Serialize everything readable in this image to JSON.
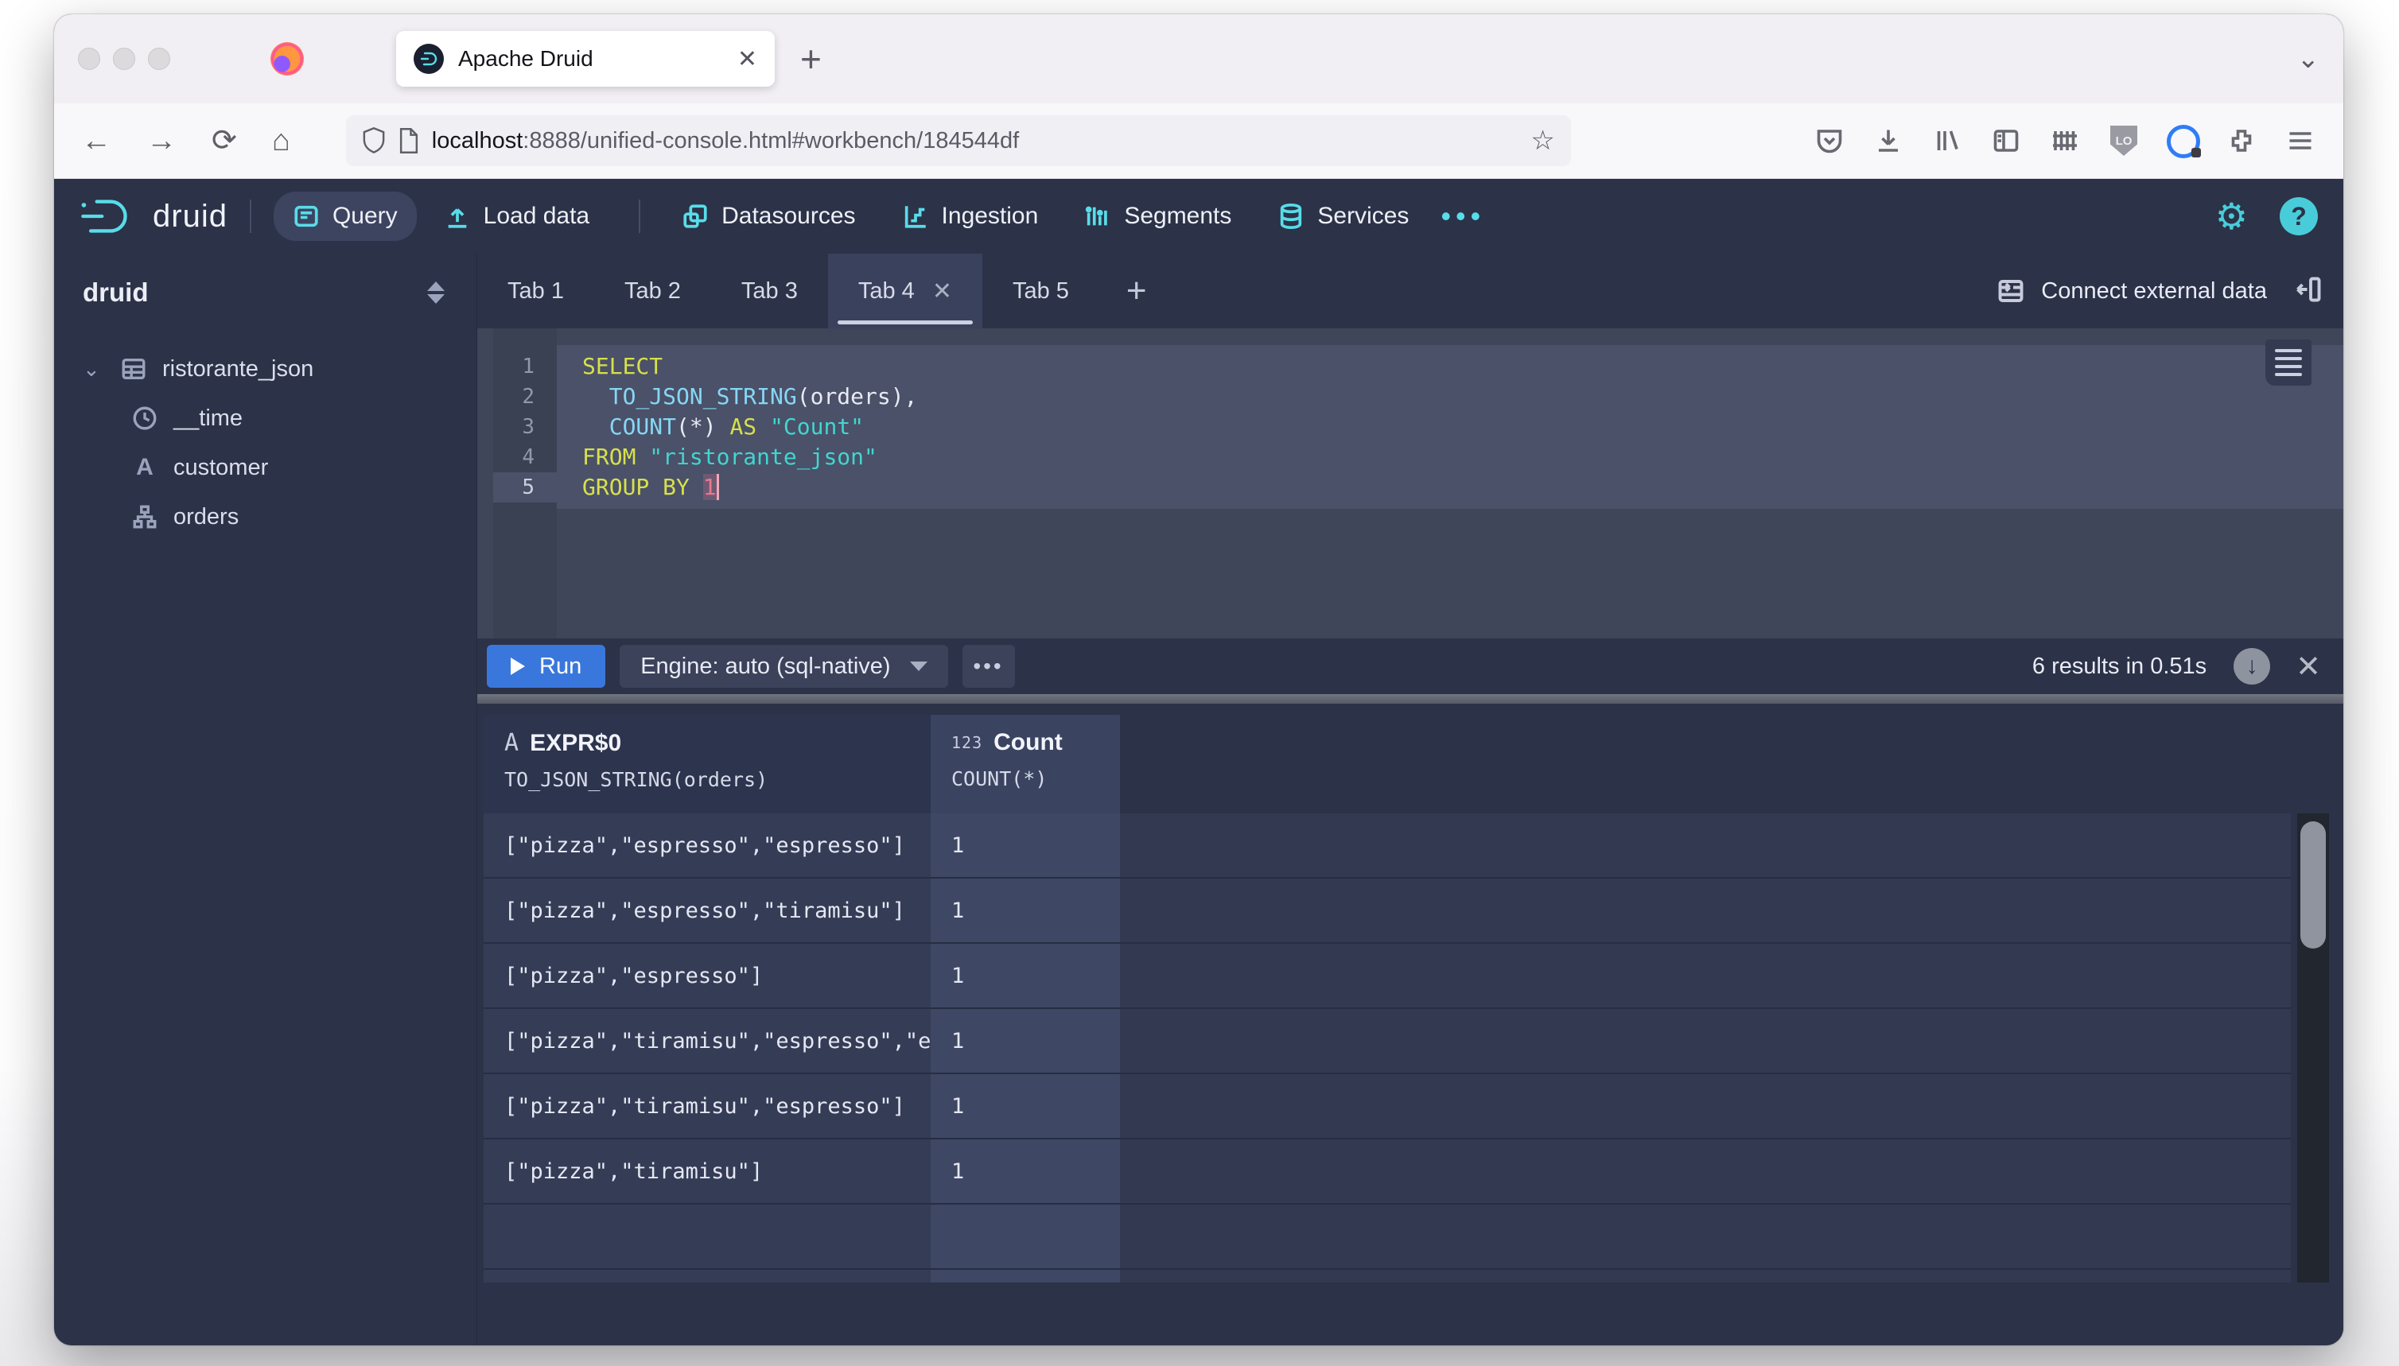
{
  "colors": {
    "accent_cyan": "#57dde9",
    "run_blue": "#3a77dc",
    "keyword": "#d8e04b",
    "function": "#86d7f5",
    "string": "#41d6cf",
    "number": "#e8788f"
  },
  "browser": {
    "tab_title": "Apache Druid",
    "url_host": "localhost",
    "url_rest": ":8888/unified-console.html#workbench/184544df"
  },
  "nav": {
    "brand": "druid",
    "items": [
      {
        "label": "Query"
      },
      {
        "label": "Load data"
      },
      {
        "label": "Datasources"
      },
      {
        "label": "Ingestion"
      },
      {
        "label": "Segments"
      },
      {
        "label": "Services"
      }
    ]
  },
  "sidebar": {
    "schema": "druid",
    "table": "ristorante_json",
    "columns": [
      {
        "name": "__time",
        "type": "time"
      },
      {
        "name": "customer",
        "type": "string"
      },
      {
        "name": "orders",
        "type": "complex"
      }
    ]
  },
  "workbench": {
    "tabs": [
      "Tab 1",
      "Tab 2",
      "Tab 3",
      "Tab 4",
      "Tab 5"
    ],
    "active_tab": "Tab 4",
    "connect_label": "Connect external data"
  },
  "editor": {
    "lines": [
      {
        "tokens": [
          {
            "t": "SELECT",
            "c": "kw"
          }
        ]
      },
      {
        "tokens": [
          {
            "t": "  ",
            "c": "pl"
          },
          {
            "t": "TO_JSON_STRING",
            "c": "fn"
          },
          {
            "t": "(orders),",
            "c": "pl"
          }
        ]
      },
      {
        "tokens": [
          {
            "t": "  ",
            "c": "pl"
          },
          {
            "t": "COUNT",
            "c": "fn"
          },
          {
            "t": "(*) ",
            "c": "pl"
          },
          {
            "t": "AS",
            "c": "kw"
          },
          {
            "t": " ",
            "c": "pl"
          },
          {
            "t": "\"Count\"",
            "c": "str"
          }
        ]
      },
      {
        "tokens": [
          {
            "t": "FROM",
            "c": "kw"
          },
          {
            "t": " ",
            "c": "pl"
          },
          {
            "t": "\"ristorante_json\"",
            "c": "str"
          }
        ]
      },
      {
        "tokens": [
          {
            "t": "GROUP BY",
            "c": "kw"
          },
          {
            "t": " ",
            "c": "pl"
          },
          {
            "t": "1",
            "c": "num cursor"
          }
        ]
      }
    ]
  },
  "runbar": {
    "run_label": "Run",
    "engine_label": "Engine: auto (sql-native)",
    "more_label": "...",
    "status": "6 results in 0.51s"
  },
  "results": {
    "columns": [
      {
        "type_glyph": "A",
        "name": "EXPR$0",
        "expr": "TO_JSON_STRING(orders)"
      },
      {
        "type_glyph": "123",
        "name": "Count",
        "expr": "COUNT(*)"
      }
    ],
    "rows": [
      [
        "[\"pizza\",\"espresso\",\"espresso\"]",
        "1"
      ],
      [
        "[\"pizza\",\"espresso\",\"tiramisu\"]",
        "1"
      ],
      [
        "[\"pizza\",\"espresso\"]",
        "1"
      ],
      [
        "[\"pizza\",\"tiramisu\",\"espresso\",\"espresso\"]",
        "1"
      ],
      [
        "[\"pizza\",\"tiramisu\",\"espresso\"]",
        "1"
      ],
      [
        "[\"pizza\",\"tiramisu\"]",
        "1"
      ]
    ]
  }
}
